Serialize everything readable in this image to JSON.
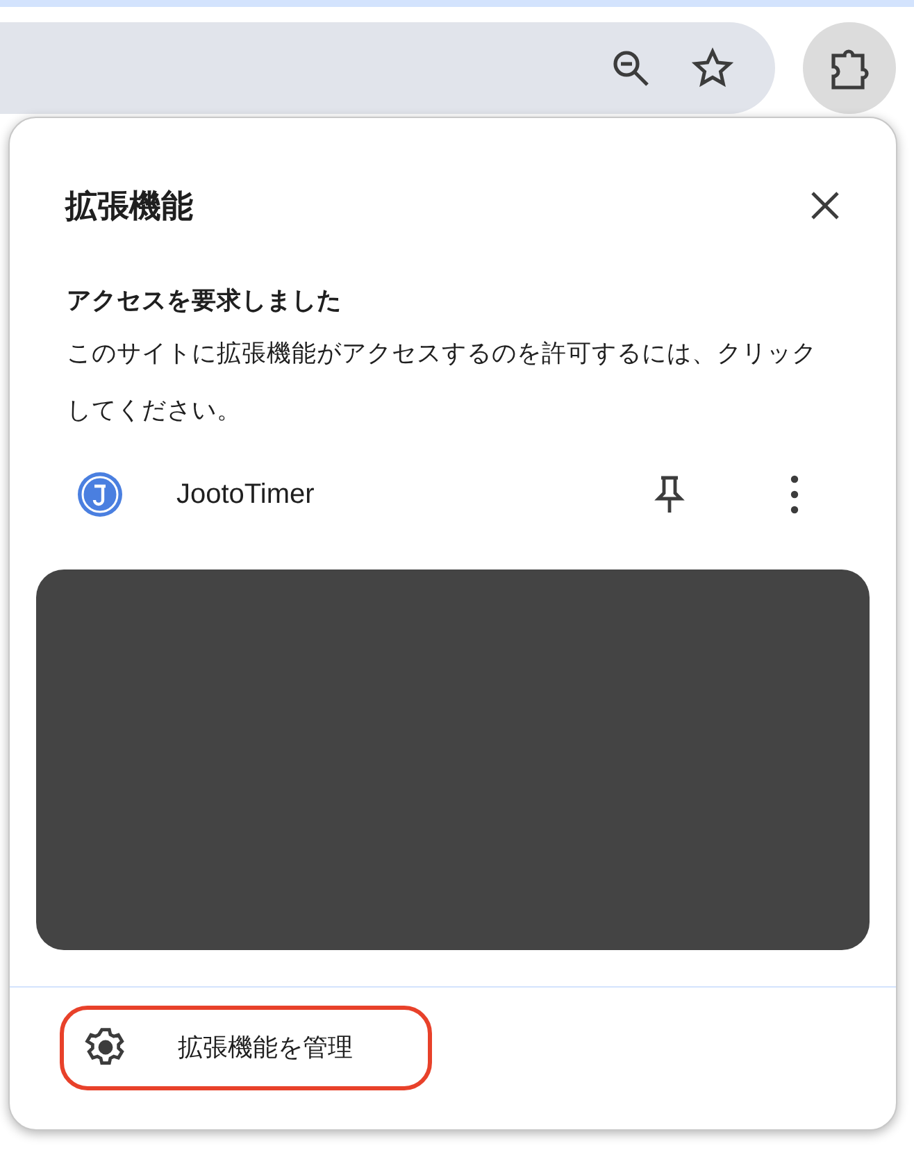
{
  "toolbar": {
    "extensions_button": {
      "selected": true
    }
  },
  "popup": {
    "title": "拡張機能",
    "message_heading": "アクセスを要求しました",
    "message": "このサイトに拡張機能がアクセスするのを許可するには、クリックしてください。",
    "extensions": [
      {
        "name": "JootoTimer"
      }
    ],
    "manage_button": {
      "label": "拡張機能を管理",
      "highlighted": true
    }
  }
}
